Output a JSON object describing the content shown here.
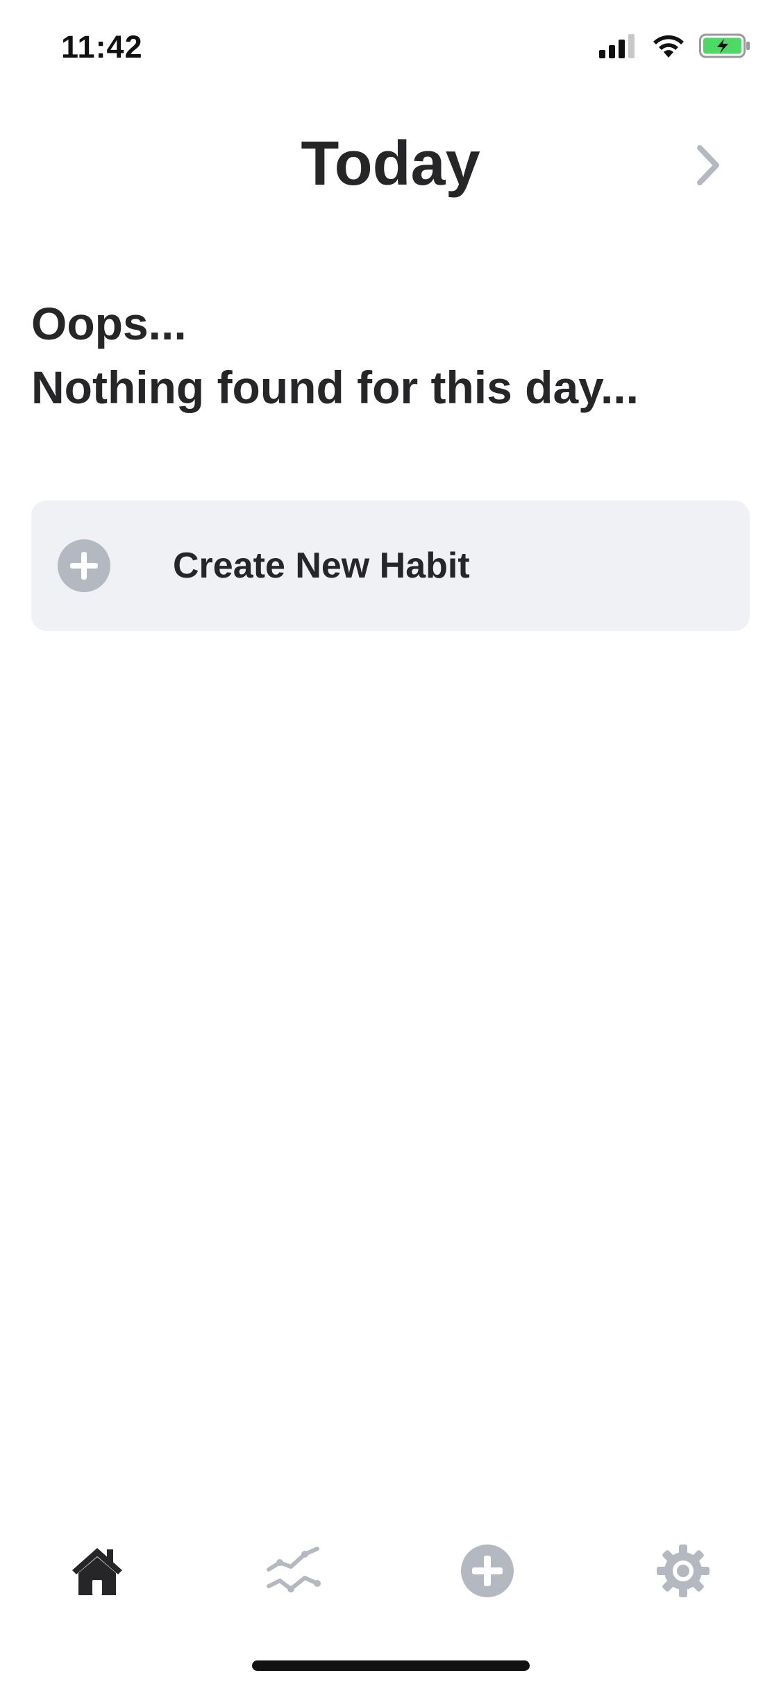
{
  "status_bar": {
    "time": "11:42",
    "icons": [
      "cellular-signal-icon",
      "wifi-icon",
      "battery-charging-icon"
    ]
  },
  "header": {
    "title": "Today",
    "next_icon": "chevron-right-icon"
  },
  "empty_state": {
    "line1": "Oops...",
    "line2": "Nothing found for this day..."
  },
  "create_card": {
    "label": "Create New Habit",
    "icon": "plus-circle-icon"
  },
  "tab_bar": {
    "tabs": [
      {
        "icon": "home-icon",
        "active": true
      },
      {
        "icon": "stats-icon",
        "active": false
      },
      {
        "icon": "add-circle-icon",
        "active": false
      },
      {
        "icon": "gear-icon",
        "active": false
      }
    ]
  },
  "colors": {
    "text": "#262628",
    "muted_icon": "#b4b9c1",
    "card_bg": "#f0f1f5",
    "battery_green": "#4cd964"
  }
}
